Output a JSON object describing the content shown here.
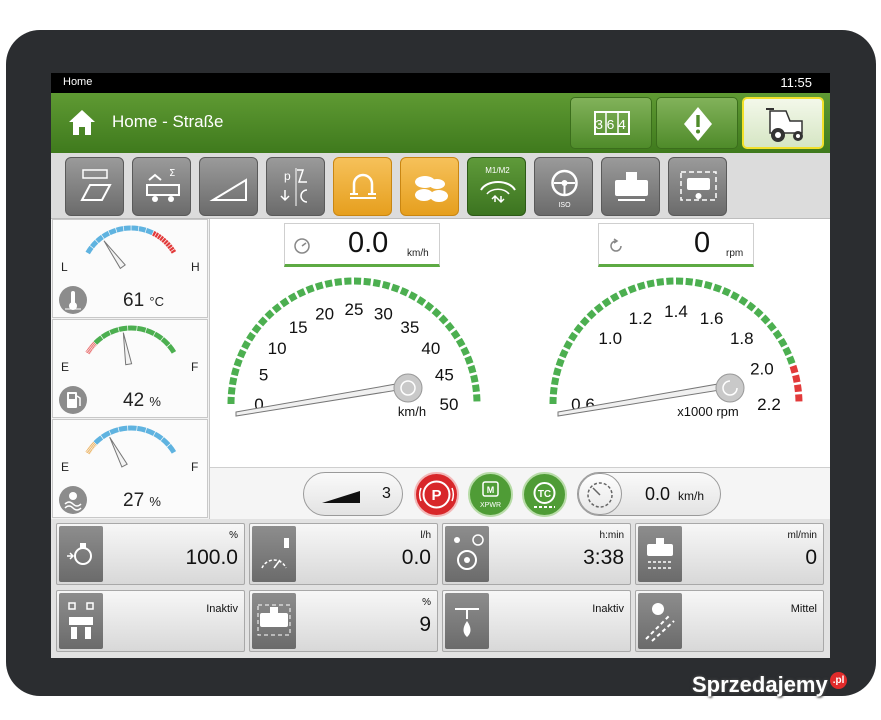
{
  "statusbar": {
    "title": "Home",
    "clock": "11:55"
  },
  "header": {
    "title": "Home - Straße",
    "buttons": [
      {
        "name": "counter-button",
        "icon": "counter-icon",
        "label": "364"
      },
      {
        "name": "warning-button",
        "icon": "warning-icon"
      },
      {
        "name": "tractor-button",
        "icon": "tractor-icon",
        "active": true
      }
    ]
  },
  "toolbar": {
    "buttons": [
      {
        "name": "field-counter-button",
        "icon": "field-counter-icon",
        "style": "gray"
      },
      {
        "name": "trailer-sum-button",
        "icon": "trailer-sum-icon",
        "style": "gray"
      },
      {
        "name": "wedge-button",
        "icon": "wedge-icon",
        "style": "gray"
      },
      {
        "name": "pto-settings-button",
        "icon": "pto-icon",
        "style": "gray"
      },
      {
        "name": "hitch-button",
        "icon": "hitch-icon",
        "style": "orange"
      },
      {
        "name": "tires-button",
        "icon": "tires-icon",
        "style": "orange"
      },
      {
        "name": "m1-m2-button",
        "icon": "m1-m2-icon",
        "label": "M1/M2",
        "style": "green"
      },
      {
        "name": "iso-button",
        "icon": "iso-steering-icon",
        "label": "ISO",
        "style": "gray"
      },
      {
        "name": "implement-button",
        "icon": "implement-icon",
        "style": "gray"
      },
      {
        "name": "monitor-button",
        "icon": "monitor-icon",
        "style": "gray"
      }
    ]
  },
  "left_gauges": [
    {
      "name": "coolant-temp",
      "icon": "thermometer-icon",
      "low_label": "L",
      "high_label": "H",
      "value": "61",
      "unit": "°C",
      "level": 0.2
    },
    {
      "name": "fuel-level",
      "icon": "fuel-icon",
      "low_label": "E",
      "high_label": "F",
      "value": "42",
      "unit": "%",
      "level": 0.42
    },
    {
      "name": "adblue-level",
      "icon": "adblue-icon",
      "low_label": "E",
      "high_label": "F",
      "value": "27",
      "unit": "%",
      "level": 0.27
    }
  ],
  "speed_readout": {
    "value": "0.0",
    "unit": "km/h",
    "icon": "speedometer-icon"
  },
  "rpm_readout": {
    "value": "0",
    "unit": "rpm",
    "icon": "rpm-icon"
  },
  "speed_dial": {
    "ticks": [
      "0",
      "5",
      "10",
      "15",
      "20",
      "25",
      "30",
      "35",
      "40",
      "45",
      "50"
    ],
    "unit": "km/h",
    "value": 0,
    "min": 0,
    "max": 50
  },
  "rpm_dial": {
    "ticks": [
      "0.6",
      "1.0",
      "1.2",
      "1.4",
      "1.6",
      "1.8",
      "2.0",
      "2.2"
    ],
    "unit": "x1000 rpm",
    "value": 0.6,
    "min": 0.6,
    "max": 2.2
  },
  "status_row": {
    "gear": "3",
    "parking_icon": "parking-brake-icon",
    "xpwr_label": "XPWR",
    "tc_label": "TC",
    "cruise_value": "0.0",
    "cruise_unit": "km/h"
  },
  "cells": [
    {
      "name": "engine-load",
      "icon": "engine-icon",
      "unit": "%",
      "value": "100.0"
    },
    {
      "name": "fuel-consumption",
      "icon": "fuel-rate-icon",
      "unit": "l/h",
      "value": "0.0"
    },
    {
      "name": "operating-hours",
      "icon": "hours-icon",
      "unit": "h:min",
      "value": "3:38"
    },
    {
      "name": "adblue-consumption",
      "icon": "adblue-rate-icon",
      "unit": "ml/min",
      "value": "0"
    },
    {
      "name": "hitch-status",
      "icon": "hitch-status-icon",
      "status": "Inaktiv"
    },
    {
      "name": "adblue-percent",
      "icon": "adblue-tank-icon",
      "unit": "%",
      "value": "9"
    },
    {
      "name": "sprayer-status",
      "icon": "sprayer-icon",
      "status": "Inaktiv"
    },
    {
      "name": "wheel-slip",
      "icon": "wheel-slip-icon",
      "status": "Mittel"
    }
  ],
  "watermark": {
    "text": "Sprzedajemy",
    "suffix": ".pl"
  }
}
